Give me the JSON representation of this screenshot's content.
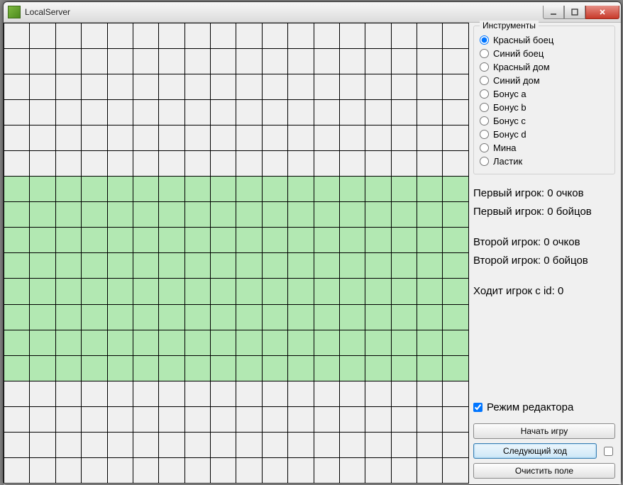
{
  "window": {
    "title": "LocalServer"
  },
  "grid": {
    "cols": 18,
    "rows": 18,
    "band_start": 6,
    "band_end": 13
  },
  "tools": {
    "group_title": "Инструменты",
    "items": [
      {
        "id": "red-fighter",
        "label": "Красный боец",
        "checked": true
      },
      {
        "id": "blue-fighter",
        "label": "Синий боец",
        "checked": false
      },
      {
        "id": "red-house",
        "label": "Красный дом",
        "checked": false
      },
      {
        "id": "blue-house",
        "label": "Синий дом",
        "checked": false
      },
      {
        "id": "bonus-a",
        "label": "Бонус a",
        "checked": false
      },
      {
        "id": "bonus-b",
        "label": "Бонус b",
        "checked": false
      },
      {
        "id": "bonus-c",
        "label": "Бонус c",
        "checked": false
      },
      {
        "id": "bonus-d",
        "label": "Бонус d",
        "checked": false
      },
      {
        "id": "mine",
        "label": "Мина",
        "checked": false
      },
      {
        "id": "eraser",
        "label": "Ластик",
        "checked": false
      }
    ]
  },
  "stats": {
    "p1_score": "Первый игрок: 0 очков",
    "p1_fighters": "Первый игрок: 0 бойцов",
    "p2_score": "Второй игрок: 0 очков",
    "p2_fighters": "Второй игрок: 0 бойцов",
    "turn": "Ходит игрок с id: 0"
  },
  "editor": {
    "label": "Режим редактора",
    "checked": true
  },
  "buttons": {
    "start": "Начать игру",
    "next": "Следующий ход",
    "clear": "Очистить поле"
  }
}
